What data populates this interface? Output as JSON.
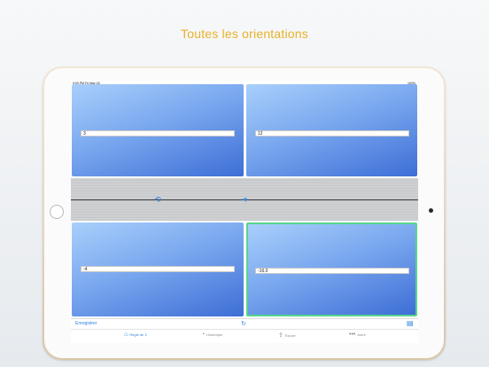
{
  "headline": "Toutes les orientations",
  "status_bar": {
    "time": "9:00 PM  Fri May 18",
    "right": "100%"
  },
  "panels": {
    "top_left": {
      "value": "3"
    },
    "top_right": {
      "value": "12"
    },
    "bottom_left": {
      "value": "-4"
    },
    "bottom_right": {
      "value": "-16.0"
    }
  },
  "toolbar": {
    "save_label": "Enregistrer"
  },
  "tabs": [
    {
      "label": "Règle de 3",
      "icon": "home-icon"
    },
    {
      "label": "Historique",
      "icon": "clock-icon"
    },
    {
      "label": "Export",
      "icon": "share-icon"
    },
    {
      "label": "Autre",
      "icon": "more-icon"
    }
  ],
  "colors": {
    "accent": "#2f82e0",
    "headline": "#e7b22a",
    "selected_border": "#57d48c"
  }
}
